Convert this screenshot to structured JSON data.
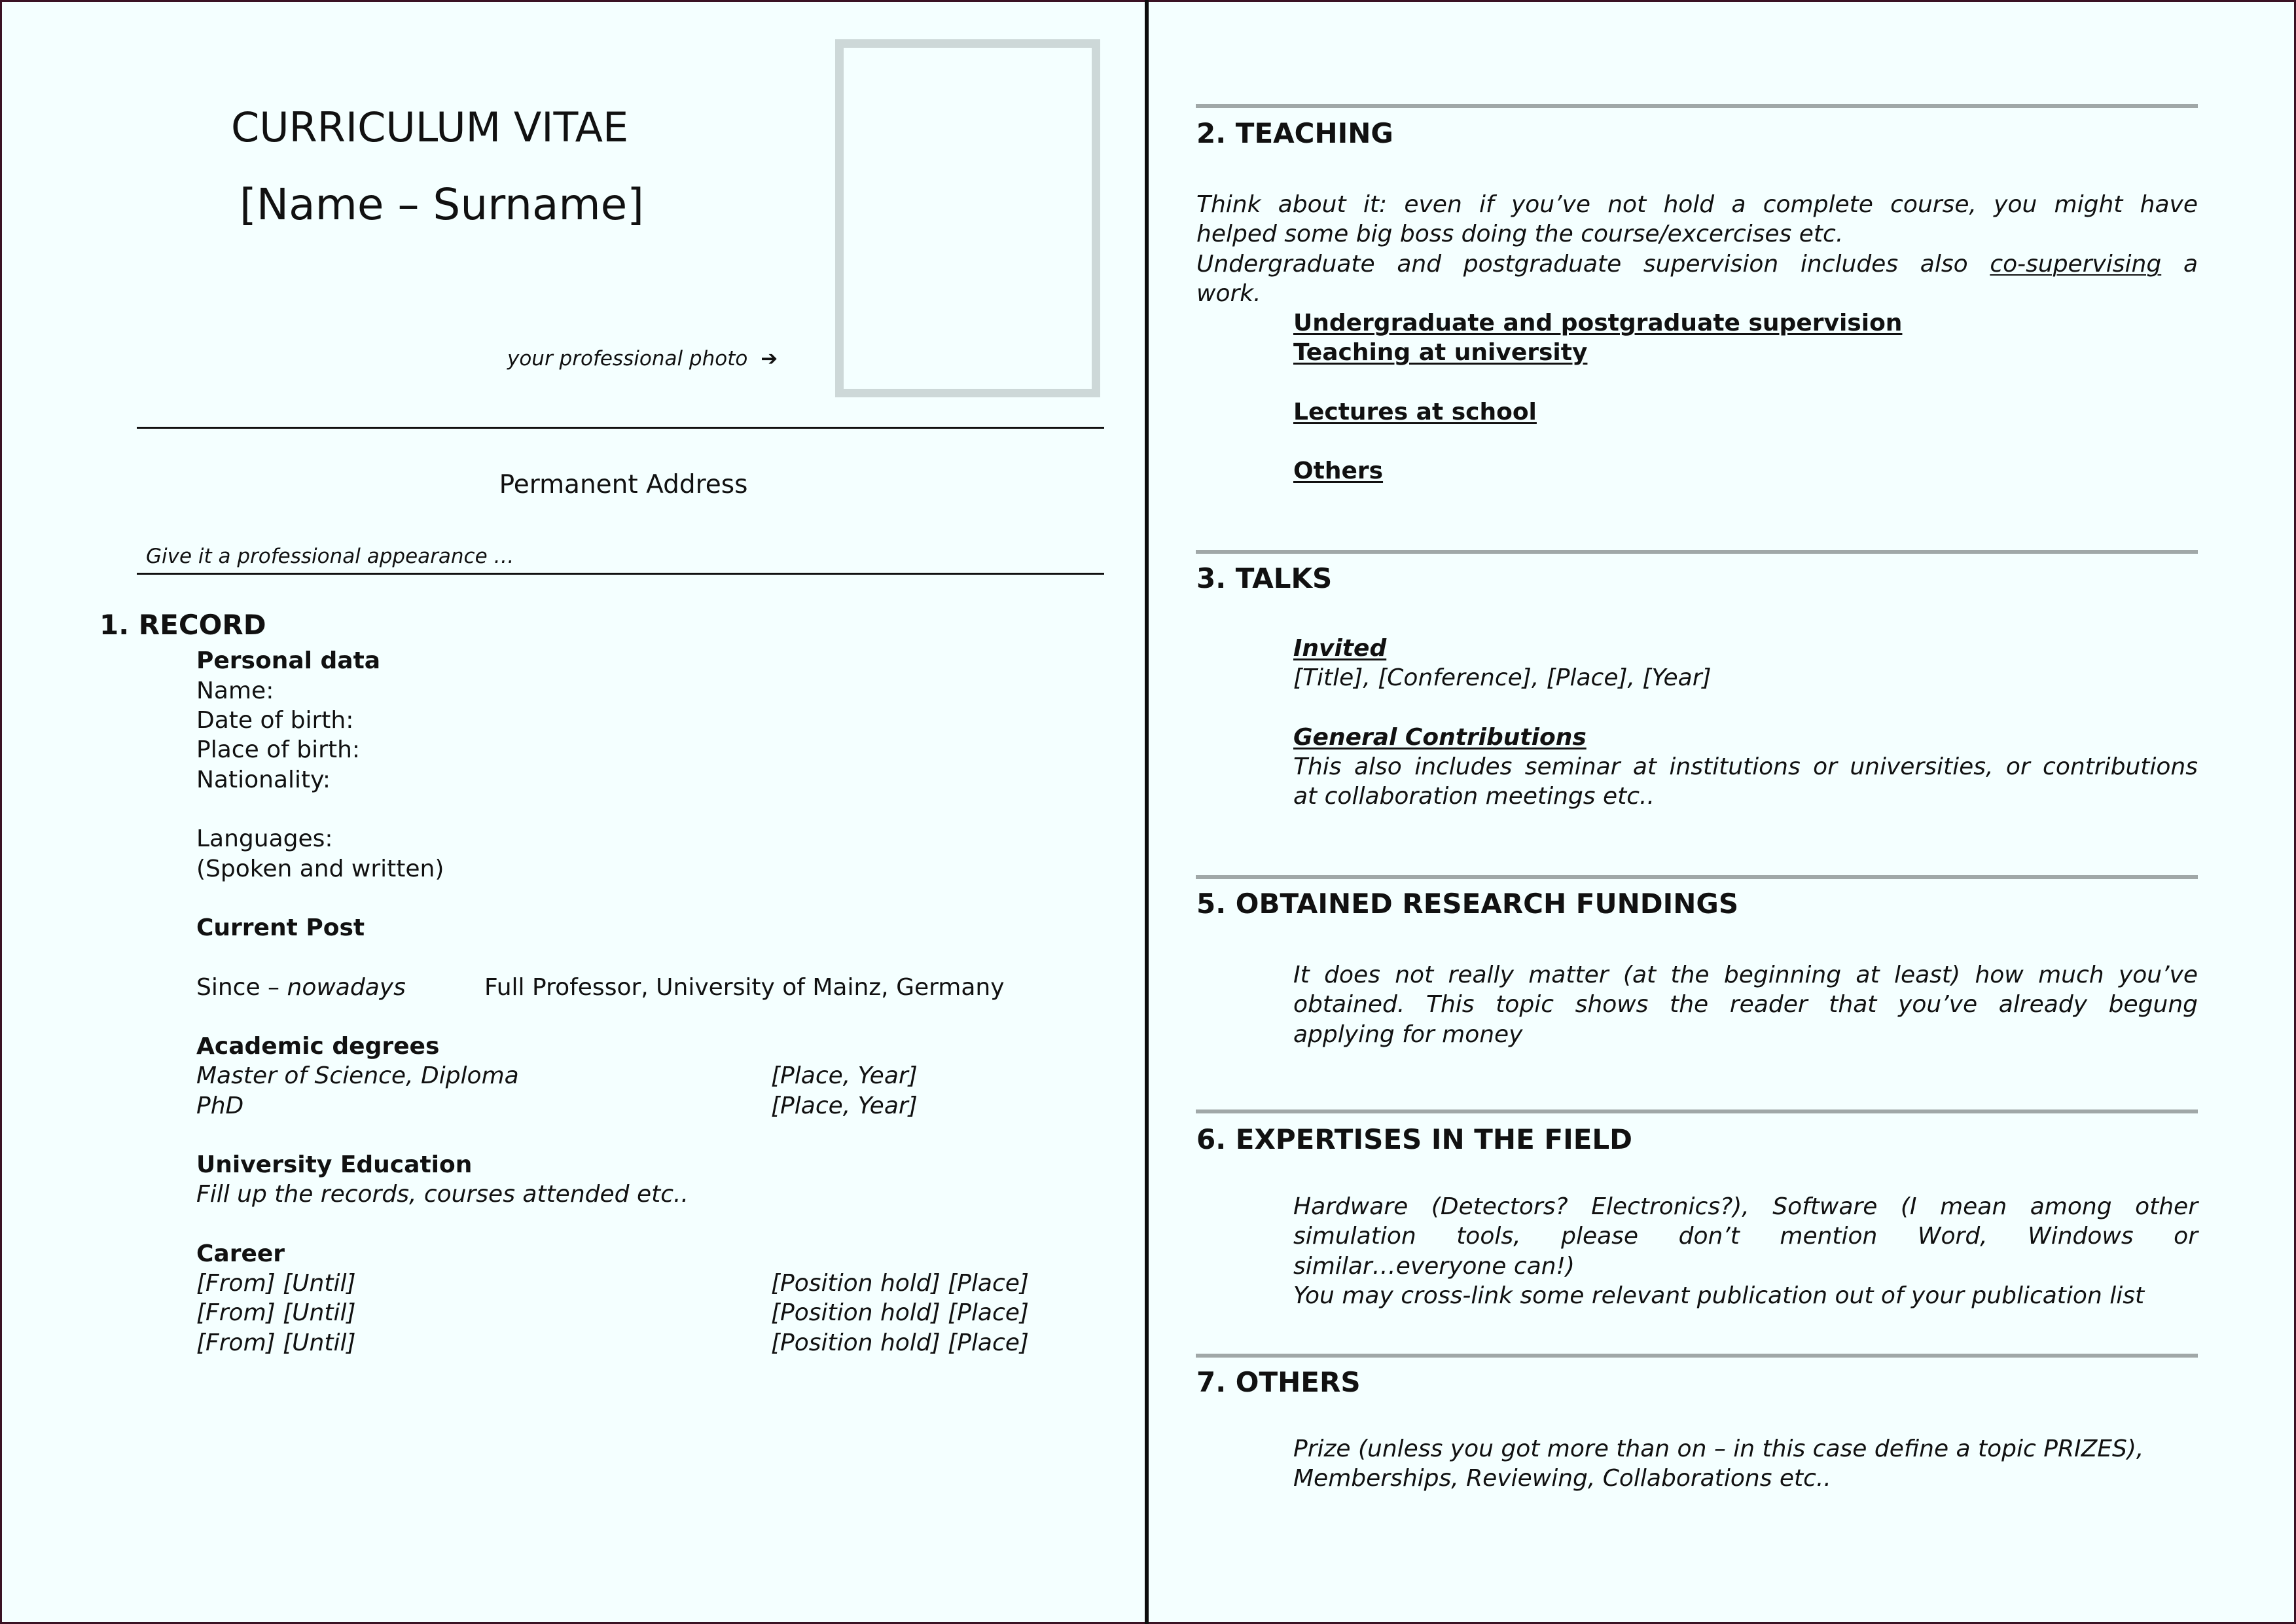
{
  "left_page": {
    "title": "CURRICULUM VITAE",
    "name": "[Name – Surname]",
    "photo_caption": "your professional photo",
    "photo_arrow_icon": "➔",
    "permanent_address": "Permanent Address",
    "appearance_hint": "Give it a professional appearance …",
    "record": {
      "heading": "1. RECORD",
      "personal_data": {
        "heading": "Personal data",
        "fields": [
          "Name:",
          "Date of birth:",
          "Place of birth:",
          "Nationality:"
        ],
        "languages_label": "Languages:",
        "languages_note": "(Spoken and written)"
      },
      "current_post": {
        "heading": "Current Post",
        "since": "Since – ",
        "since_italic": "nowadays",
        "position": "Full Professor, University of Mainz, Germany"
      },
      "academic_degrees": {
        "heading": "Academic degrees",
        "rows": [
          {
            "degree": "Master of Science, Diploma",
            "where": "[Place, Year]"
          },
          {
            "degree": "PhD",
            "where": "[Place, Year]"
          }
        ]
      },
      "university_education": {
        "heading": "University Education",
        "note": "Fill up the records, courses attended etc.."
      },
      "career": {
        "heading": "Career",
        "rows": [
          {
            "period": "[From] [Until]",
            "position": "[Position hold] [Place]"
          },
          {
            "period": "[From] [Until]",
            "position": "[Position hold] [Place]"
          },
          {
            "period": "[From] [Until]",
            "position": "[Position hold] [Place]"
          }
        ]
      }
    }
  },
  "right_page": {
    "teaching": {
      "heading": "2. TEACHING",
      "para_lines": [
        "Think about it: even if you’ve not hold a complete course, you might have",
        "helped some big boss doing the course/excercises etc."
      ],
      "para2_line1_prefix": "Undergraduate and postgraduate supervision includes also",
      "para2_link": "co-supervising",
      "para2_line1_suffix": "a",
      "para2_line2": "work.",
      "items": [
        "Undergraduate and postgraduate supervision",
        "Teaching at university",
        "Lectures at school",
        "Others"
      ]
    },
    "talks": {
      "heading": "3. TALKS",
      "invited_label": "Invited",
      "invited_text": "[Title], [Conference], [Place], [Year]",
      "general_label": "General Contributions",
      "general_lines": [
        "This also includes seminar at institutions or universities, or contributions",
        "at collaboration meetings etc.."
      ]
    },
    "fundings": {
      "heading": "5. OBTAINED RESEARCH FUNDINGS",
      "lines": [
        "It does not really matter (at the beginning at least) how much you’ve",
        "obtained. This topic shows the reader that you’ve already begung",
        "applying for money"
      ]
    },
    "expertises": {
      "heading": "6. EXPERTISES IN THE FIELD",
      "lines": [
        "Hardware (Detectors? Electronics?), Software (I mean among other",
        "simulation tools, please don’t mention Word, Windows or",
        "similar…everyone can!)",
        "You may cross-link some relevant publication out of your publication list"
      ]
    },
    "others": {
      "heading": "7. OTHERS",
      "lines": [
        "Prize (unless you got more than on – in this case define a topic PRIZES),",
        "Memberships, Reviewing, Collaborations etc.."
      ]
    }
  },
  "colors": {
    "background": "#f4ffff",
    "page_border": "#3a1224",
    "section_rule": "#a0a8a8",
    "photo_frame": "#cdd8d8",
    "text": "#111111"
  }
}
